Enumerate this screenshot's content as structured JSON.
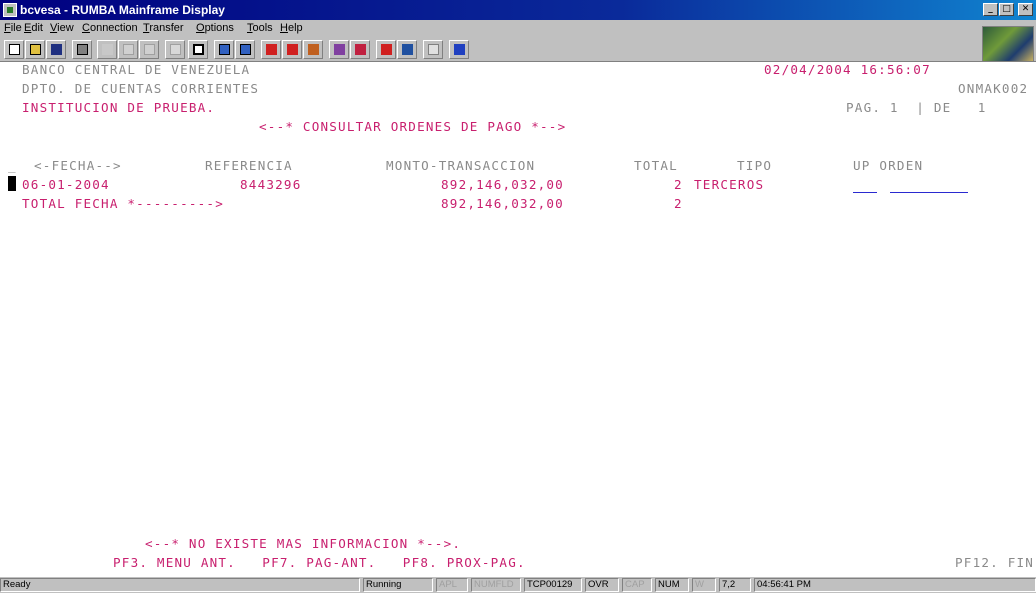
{
  "window": {
    "title": "bcvesa - RUMBA Mainframe Display"
  },
  "menu": [
    "File",
    "Edit",
    "View",
    "Connection",
    "Transfer",
    "Options",
    "Tools",
    "Help"
  ],
  "toolbar": [
    "new-icon",
    "open-icon",
    "save-icon",
    "print-icon",
    "cut-icon",
    "copy-icon",
    "paste-icon",
    "undo-icon",
    "tree-icon",
    "connect-icon",
    "disconnect-icon",
    "transfer-up-icon",
    "transfer-down-icon",
    "macro-icon",
    "hotspot-icon",
    "settings-icon",
    "keyboard-icon",
    "monitor-icon",
    "text-icon",
    "help-icon"
  ],
  "screen": {
    "bank": "BANCO CENTRAL DE VENEZUELA",
    "datetime": "02/04/2004 16:56:07",
    "dept": "DPTO. DE CUENTAS CORRIENTES",
    "screen_id": "ONMAK002",
    "institution": "INSTITUCION DE PRUEBA.",
    "page": "PAG. 1  | DE   1",
    "title": "<--* CONSULTAR ORDENES DE PAGO *-->",
    "row_marker": "_",
    "headers": {
      "fecha": "<-FECHA-->",
      "referencia": "REFERENCIA",
      "monto": "MONTO-TRANSACCION",
      "total": "TOTAL",
      "tipo": "TIPO",
      "up_orden": "UP ORDEN"
    },
    "row": {
      "fecha": "06-01-2004",
      "referencia": "8443296",
      "monto": "892,146,032,00",
      "total": "2",
      "tipo": "TERCEROS"
    },
    "totals": {
      "label": "TOTAL FECHA *--------->",
      "monto": "892,146,032,00",
      "total": "2"
    },
    "no_more": "<--* NO EXISTE MAS INFORMACION *-->.",
    "pf_keys": "PF3. MENU ANT.   PF7. PAG-ANT.   PF8. PROX-PAG.",
    "pf12": "PF12. FIN"
  },
  "status": {
    "ready": "Ready",
    "mode": "Running",
    "apl": "APL",
    "numfld": "NUMFLD",
    "session": "TCP00129",
    "ovr": "OVR",
    "cap": "CAP",
    "num": "NUM",
    "w": "W",
    "pos": "7,2",
    "time": "04:56:41 PM"
  }
}
